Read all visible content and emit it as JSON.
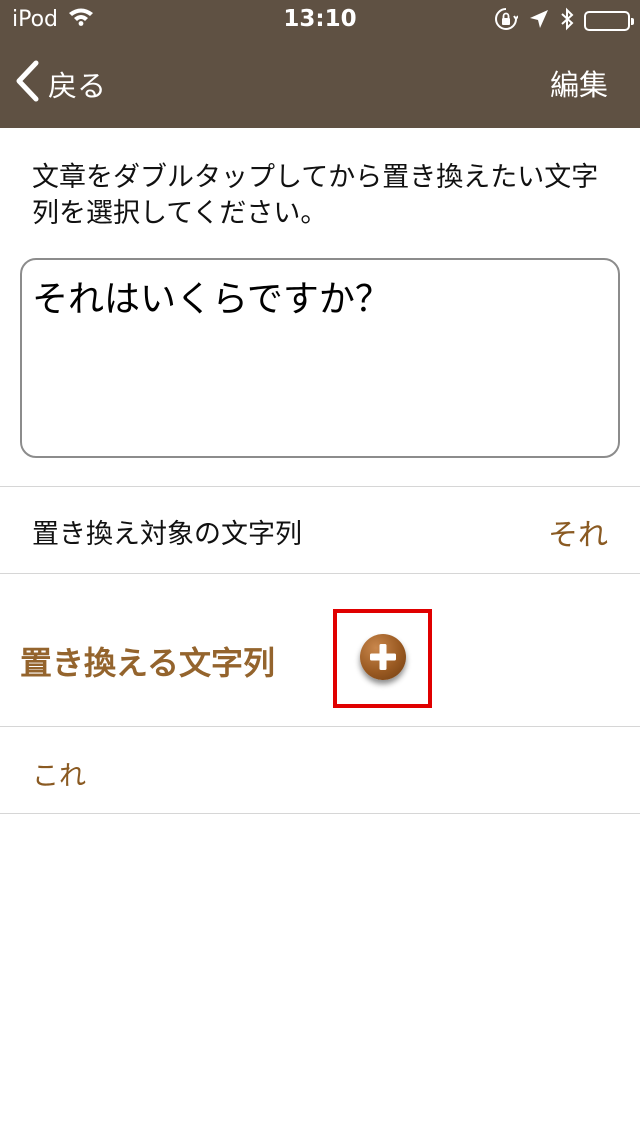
{
  "status_bar": {
    "carrier": "iPod",
    "time": "13:10",
    "icons": [
      "wifi-icon",
      "orientation-lock-icon",
      "location-icon",
      "bluetooth-icon",
      "battery-icon"
    ]
  },
  "nav": {
    "back_label": "戻る",
    "edit_label": "編集"
  },
  "instruction": "文章をダブルタップしてから置き換えたい文字列を選択してください。",
  "sentence": "それはいくらですか？",
  "target": {
    "label": "置き換え対象の文字列",
    "value": "それ"
  },
  "replacement": {
    "heading": "置き換える文字列",
    "items": [
      "これ"
    ]
  },
  "colors": {
    "nav_background": "#5f5143",
    "accent": "#94642d",
    "highlight": "#e00000"
  }
}
